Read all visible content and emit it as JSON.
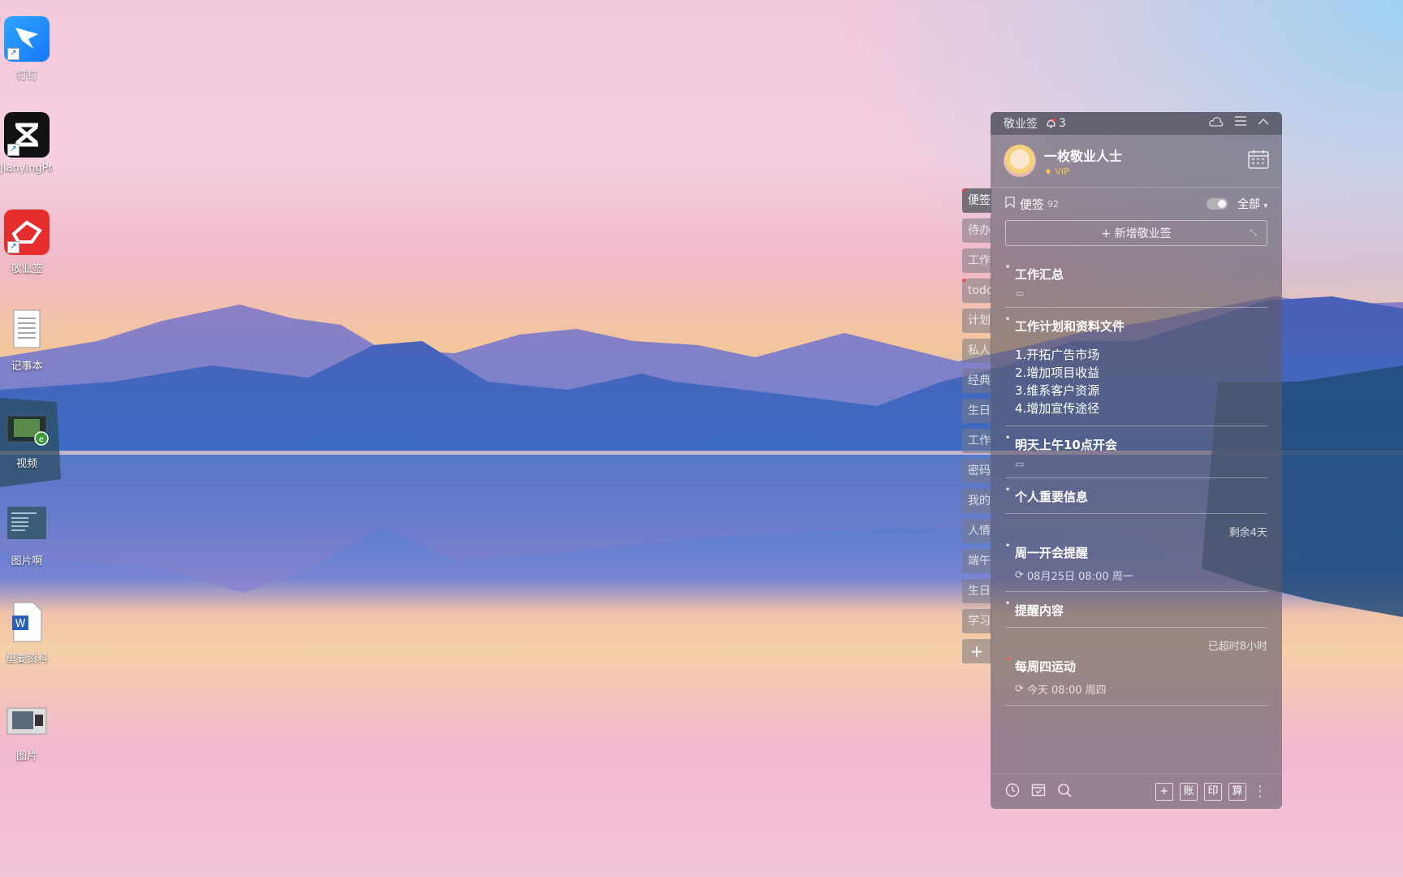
{
  "desktop": {
    "icons": [
      {
        "label": "钉钉",
        "icon": "dingtalk-icon"
      },
      {
        "label": "JianyingPro",
        "icon": "capcut-icon"
      },
      {
        "label": "敬业签",
        "icon": "jingyeqian-icon"
      },
      {
        "label": "记事本",
        "icon": "notepad-icon"
      },
      {
        "label": "视频",
        "icon": "video-folder-icon"
      },
      {
        "label": "图片啊",
        "icon": "image-file-icon"
      },
      {
        "label": "重要资料",
        "icon": "word-doc-icon"
      },
      {
        "label": "图片",
        "icon": "photo-folder-icon"
      }
    ]
  },
  "side_tabs": [
    "便签",
    "待办",
    "工作",
    "todo",
    "计划",
    "私人",
    "经典",
    "生日",
    "工作",
    "密码",
    "我的",
    "人情",
    "端午",
    "生日",
    "学习"
  ],
  "side_tab_add": "+",
  "panel": {
    "app_name": "敬业签",
    "bell_count": "3",
    "user": {
      "name": "一枚敬业人士",
      "badge": "VIP"
    },
    "filter": {
      "label": "便签",
      "count": "92",
      "scope": "全部"
    },
    "new_note": "+ 新增敬业签",
    "notes": [
      {
        "title": "工作汇总"
      },
      {
        "title": "工作计划和资料文件",
        "lines": [
          "1.开拓广告市场",
          "2.增加项目收益",
          "3.维系客户资源",
          "4.增加宣传途径"
        ]
      },
      {
        "title": "明天上午10点开会"
      },
      {
        "title": "个人重要信息"
      },
      {
        "title": "周一开会提醒",
        "status": "剩余4天",
        "reminder": "08月25日 08:00 周一"
      },
      {
        "title": "提醒内容"
      },
      {
        "title": "每周四运动",
        "status": "已超时8小时",
        "reminder": "今天 08:00 周四"
      }
    ],
    "bottom_buttons": [
      "账",
      "印",
      "算"
    ]
  }
}
